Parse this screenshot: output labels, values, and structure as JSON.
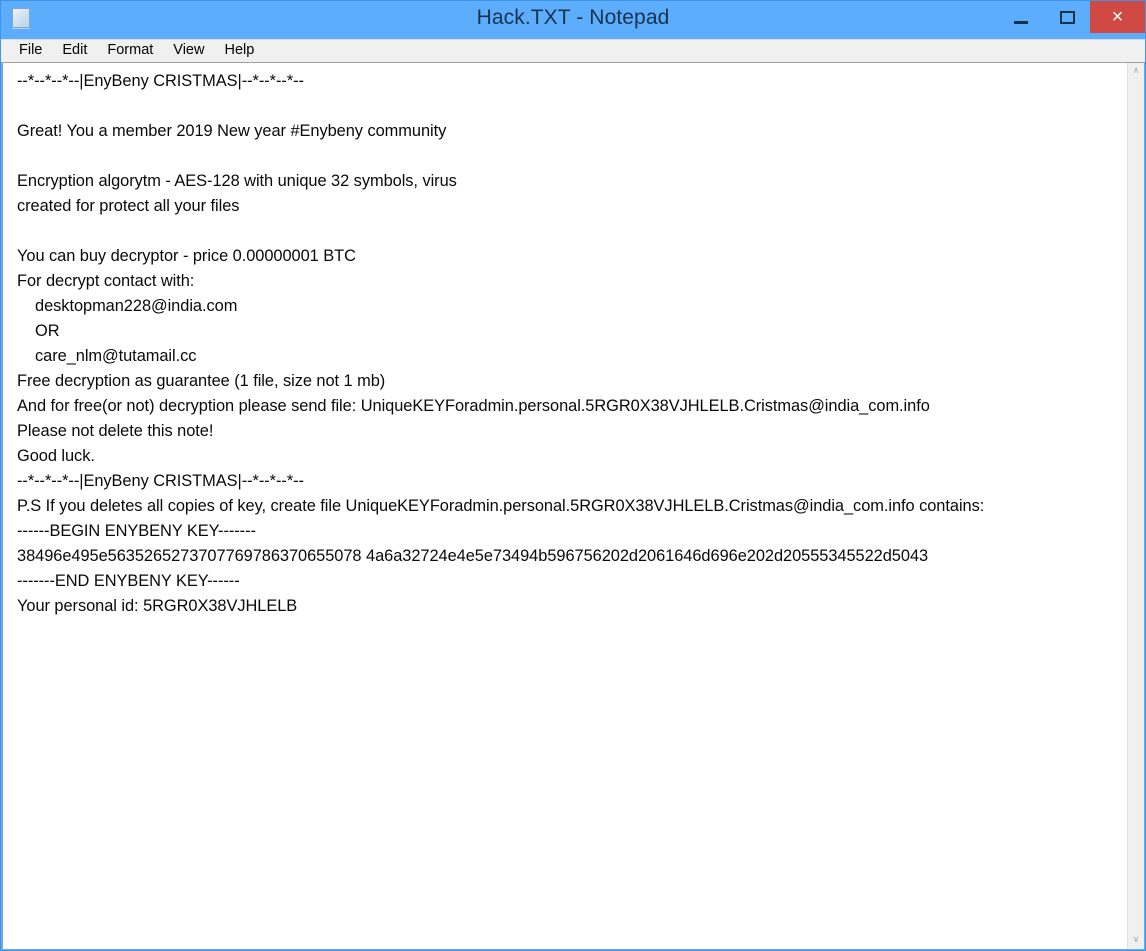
{
  "window": {
    "title": "Hack.TXT - Notepad",
    "app_icon": "notepad-document-icon",
    "titlebar_color": "#5caefc",
    "close_button_color": "#d04a43",
    "controls": {
      "minimize": "minimize-icon",
      "maximize": "maximize-icon",
      "close": "×"
    }
  },
  "menubar": {
    "items": [
      {
        "label": "File"
      },
      {
        "label": "Edit"
      },
      {
        "label": "Format"
      },
      {
        "label": "View"
      },
      {
        "label": "Help"
      }
    ]
  },
  "editor": {
    "content": "--*--*--*--|EnyBeny CRISTMAS|--*--*--*--\n\nGreat! You a member 2019 New year #Enybeny community\n\nEncryption algorytm - AES-128 with unique 32 symbols, virus\ncreated for protect all your files\n\nYou can buy decryptor - price 0.00000001 BTC\nFor decrypt contact with:\n    desktopman228@india.com\n    OR\n    care_nlm@tutamail.cc\nFree decryption as guarantee (1 file, size not 1 mb)\nAnd for free(or not) decryption please send file: UniqueKEYForadmin.personal.5RGR0X38VJHLELB.Cristmas@india_com.info\nPlease not delete this note!\nGood luck.\n--*--*--*--|EnyBeny CRISTMAS|--*--*--*--\nP.S If you deletes all copies of key, create file UniqueKEYForadmin.personal.5RGR0X38VJHLELB.Cristmas@india_com.info contains:\n------BEGIN ENYBENY KEY-------\n38496e495e5635265273707769786370655078 4a6a32724e4e5e73494b596756202d2061646d696e202d20555345522d5043\n-------END ENYBENY KEY------\nYour personal id: 5RGR0X38VJHLELB",
    "lines": [
      "--*--*--*--|EnyBeny CRISTMAS|--*--*--*--",
      "",
      "Great! You a member 2019 New year #Enybeny community",
      "",
      "Encryption algorytm - AES-128 with unique 32 symbols, virus",
      "created for protect all your files",
      "",
      "You can buy decryptor - price 0.00000001 BTC",
      "For decrypt contact with:",
      "    desktopman228@india.com",
      "    OR",
      "    care_nlm@tutamail.cc",
      "Free decryption as guarantee (1 file, size not 1 mb)",
      "And for free(or not) decryption please send file: UniqueKEYForadmin.personal.5RGR0X38VJHLELB.Cristmas@india_com.info",
      "Please not delete this note!",
      "Good luck.",
      "--*--*--*--|EnyBeny CRISTMAS|--*--*--*--",
      "P.S If you deletes all copies of key, create file UniqueKEYForadmin.personal.5RGR0X38VJHLELB.Cristmas@india_com.info contains:",
      "------BEGIN ENYBENY KEY-------",
      "38496e495e56352652737077697863706550784a6a32724e4e5e73494b596756202d2061646d696e202d20555345522d5043",
      "-------END ENYBENY KEY------",
      "Your personal id: 5RGR0X38VJHLELB"
    ],
    "details": {
      "ransom_price": "0.00000001 BTC",
      "encryption_algorithm": "AES-128",
      "contact_email_1": "desktopman228@india.com",
      "contact_email_2": "care_nlm@tutamail.cc",
      "key_filename": "UniqueKEYForadmin.personal.5RGR0X38VJHLELB.Cristmas@india_com.info",
      "personal_id": "5RGR0X38VJHLELB",
      "key_begin_marker": "------BEGIN ENYBENY KEY-------",
      "key_end_marker": "-------END ENYBENY KEY------",
      "key_hex": "38496e495e56352652737077697863706550784a6a32724e4e5e73494b596756202d2061646d696e202d20555345522d5043"
    }
  },
  "scrollbar": {
    "up_arrow": "∧",
    "down_arrow": "∨"
  }
}
